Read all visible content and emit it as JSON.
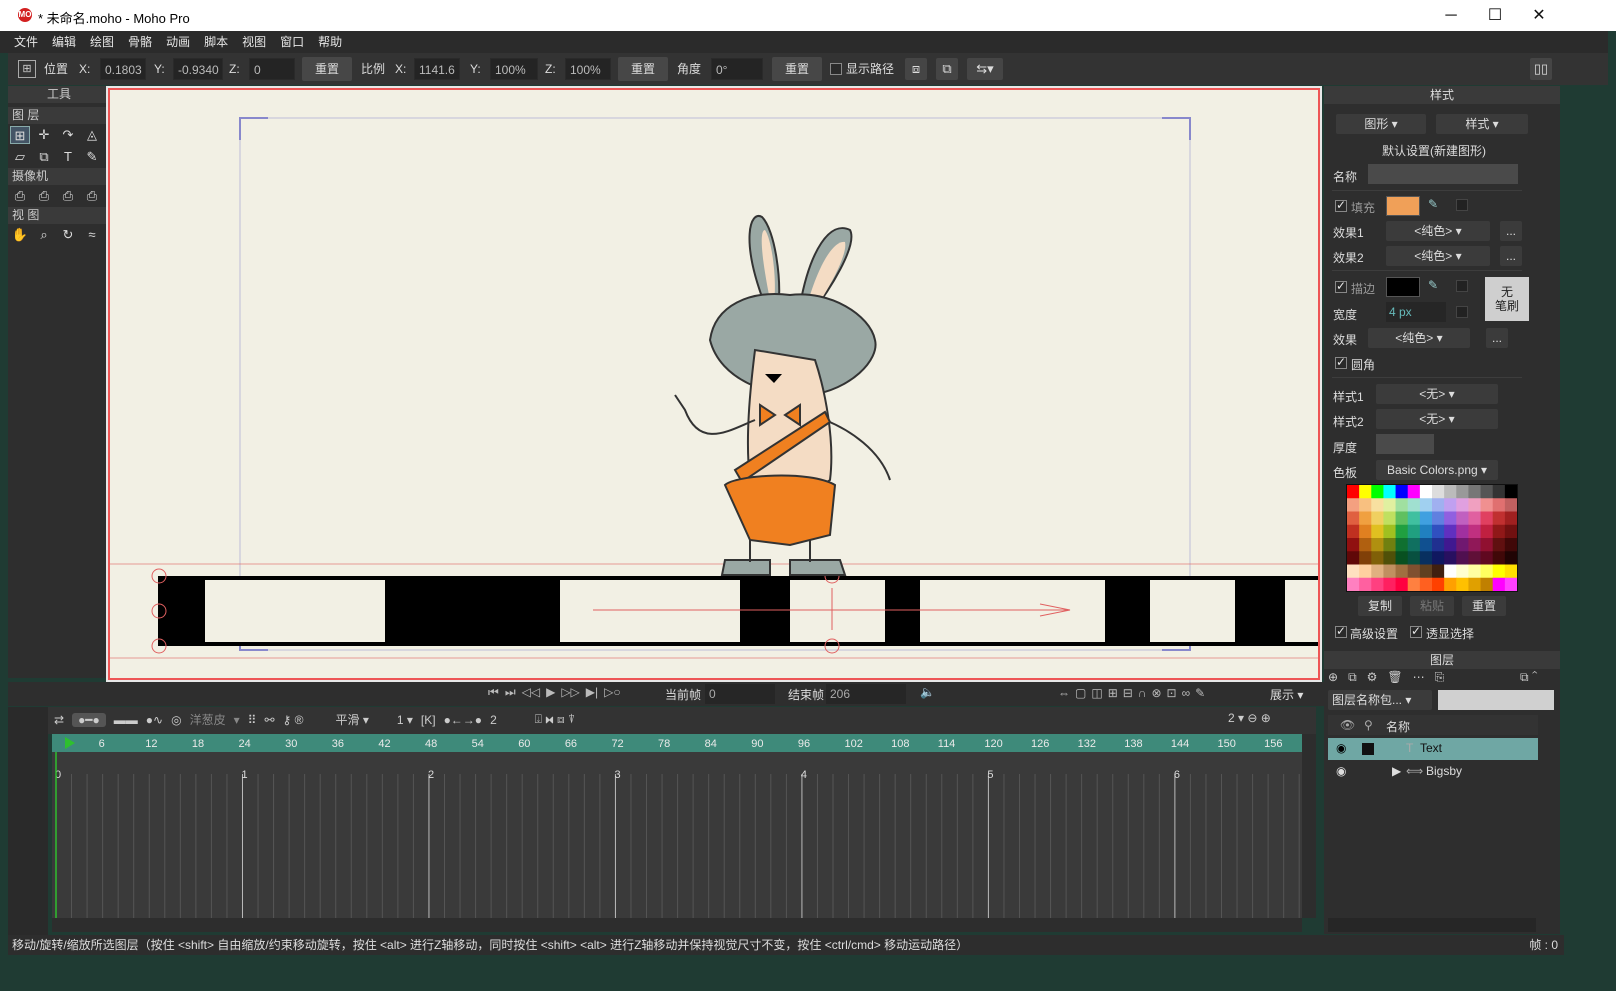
{
  "window": {
    "title": "* 未命名.moho - Moho Pro",
    "logo_text": "MO",
    "minimize": "─",
    "maximize": "☐",
    "close": "✕"
  },
  "menu": [
    "文件",
    "编辑",
    "绘图",
    "骨骼",
    "动画",
    "脚本",
    "视图",
    "窗口",
    "帮助"
  ],
  "toolbar": {
    "position_label": "位置",
    "x_label": "X:",
    "x_value": "0.1803",
    "y_label": "Y:",
    "y_value": "-0.9340",
    "z_label": "Z:",
    "z_value": "0",
    "reset1": "重置",
    "scale_label": "比例",
    "sx_label": "X:",
    "sx_value": "1141.6",
    "sy_label": "Y:",
    "sy_value": "100%",
    "sz_label": "Z:",
    "sz_value": "100%",
    "reset2": "重置",
    "angle_label": "角度",
    "angle_value": "0°",
    "reset3": "重置",
    "show_path": "显示路径"
  },
  "tools_panel": {
    "header": "工具",
    "layer_section": "图 层",
    "camera_section": "摄像机",
    "view_section": "视 图",
    "layer_tools": [
      "⊞",
      "✛",
      "↷",
      "◬",
      "▱",
      "⧉",
      "T",
      "✎"
    ],
    "camera_tools": [
      "⎙",
      "⎙",
      "⎙",
      "⎙"
    ],
    "view_tools": [
      "✋",
      "⌕",
      "↻",
      "≈"
    ]
  },
  "playback": {
    "buttons": [
      "⏮",
      "⏭",
      "◁◁",
      "▶",
      "▷▷",
      "▶|",
      "▷○"
    ],
    "current_frame_label": "当前帧",
    "current_frame": "0",
    "end_frame_label": "结束帧",
    "end_frame": "206",
    "show_label": "展示"
  },
  "timeline_toolbar": {
    "onion_label": "洋葱皮",
    "smooth_label": "平滑",
    "interp_value": "1",
    "step_value": "2",
    "zoom_value": "2"
  },
  "ruler_ticks": [
    "0",
    "6",
    "12",
    "18",
    "24",
    "30",
    "36",
    "42",
    "48",
    "54",
    "60",
    "66",
    "72",
    "78",
    "84",
    "90",
    "96",
    "102",
    "108",
    "114",
    "120",
    "126",
    "132",
    "138",
    "144",
    "150",
    "156"
  ],
  "seconds": [
    "0",
    "1",
    "2",
    "3",
    "4",
    "5",
    "6"
  ],
  "status": {
    "hint": "移动/旋转/缩放所选图层（按住 <shift> 自由缩放/约束移动旋转，按住 <alt> 进行Z轴移动，同时按住 <shift> <alt> 进行Z轴移动并保持视觉尺寸不变，按住 <ctrl/cmd> 移动运动路径）",
    "frame": "帧 : 0"
  },
  "style_panel": {
    "header": "样式",
    "shape_dd": "图形",
    "style_dd": "样式",
    "defaults_title": "默认设置(新建图形)",
    "name_label": "名称",
    "fill_label": "填充",
    "effect1_label": "效果1",
    "effect1_value": "<纯色>",
    "effect2_label": "效果2",
    "effect2_value": "<纯色>",
    "stroke_label": "描边",
    "no_brush": "无\n笔刷",
    "width_label": "宽度",
    "width_value": "4 px",
    "effect_label": "效果",
    "effect_value": "<纯色>",
    "round_label": "圆角",
    "style1_label": "样式1",
    "style1_value": "<无>",
    "style2_label": "样式2",
    "style2_value": "<无>",
    "thickness_label": "厚度",
    "palette_label": "色板",
    "palette_value": "Basic Colors.png",
    "copy": "复制",
    "paste": "粘贴",
    "reset": "重置",
    "advanced": "高级设置",
    "xray": "透显选择",
    "ellipsis": "...",
    "fill_color": "#f0a058",
    "stroke_color": "#000000"
  },
  "layers_panel": {
    "header": "图层",
    "filter_dd": "图层名称包...",
    "name_col": "名称",
    "layers": [
      {
        "name": "Text",
        "type_icon": "T",
        "selected": true
      },
      {
        "name": "Bigsby",
        "type_icon": "⟺",
        "selected": false
      }
    ]
  }
}
